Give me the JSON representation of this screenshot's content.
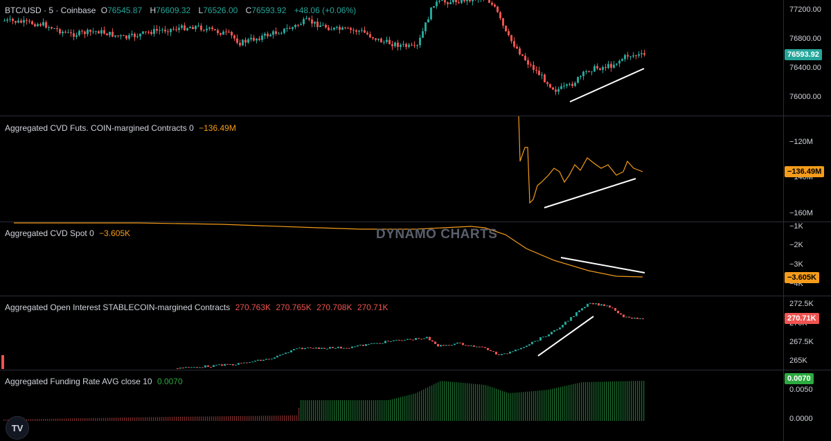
{
  "colors": {
    "up": "#26a69a",
    "down": "#ef5350",
    "cvd": "#f59c1a",
    "funding": "#26a69a",
    "trend": "#ffffff",
    "oi_badge": "#ef5350",
    "price_badge": "#26a69a",
    "funding_badge": "#2ca93f"
  },
  "main": {
    "symbol": "BTC/USD · 5 · Coinbase",
    "o_label": "O",
    "o": "76545.87",
    "h_label": "H",
    "h": "76609.32",
    "l_label": "L",
    "l": "76526.00",
    "c_label": "C",
    "c": "76593.92",
    "change": "+48.06 (+0.06%)",
    "ticks": [
      "77200.00",
      "76800.00",
      "76400.00",
      "76000.00"
    ],
    "last_price": "76593.92"
  },
  "cvd_futs": {
    "title": "Aggregated CVD Futs. COIN-margined Contracts 0",
    "value": "−136.49M",
    "ticks": [
      "−120M",
      "−140M",
      "−160M"
    ],
    "badge": "−136.49M"
  },
  "cvd_spot": {
    "title": "Aggregated CVD Spot 0",
    "value": "−3.605K",
    "ticks": [
      "−1K",
      "−2K",
      "−3K",
      "−4K"
    ],
    "badge": "−3.605K"
  },
  "oi": {
    "title": "Aggregated Open Interest STABLECOIN-margined Contracts",
    "values": [
      "270.763K",
      "270.765K",
      "270.708K",
      "270.71K"
    ],
    "ticks": [
      "272.5K",
      "270K",
      "267.5K",
      "265K"
    ],
    "badge": "270.71K"
  },
  "funding": {
    "title": "Aggregated Funding Rate AVG close 10",
    "value": "0.0070",
    "ticks": [
      "0.0050",
      "0.0000"
    ],
    "badge": "0.0070"
  },
  "watermark": "DYNAMO CHARTS",
  "logo_icon": "tradingview-logo-icon",
  "logo_text": "TV"
}
